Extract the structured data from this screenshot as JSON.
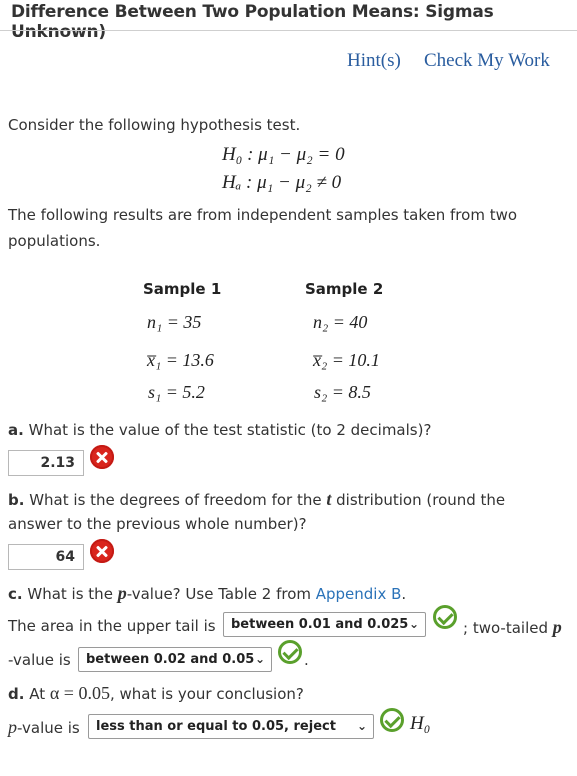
{
  "header": {
    "title": "Difference Between Two Population Means: Sigmas Unknown)",
    "hints_label": "Hint(s)",
    "check_label": "Check My Work"
  },
  "intro": {
    "line1": "Consider the following hypothesis test.",
    "h0": "H₀ : μ₁ − μ₂ = 0",
    "ha": "Hₐ : μ₁ − μ₂ ≠ 0",
    "line2a": "The following results are from independent samples taken from two",
    "line2b": "populations."
  },
  "samples": {
    "sample1_header": "Sample 1",
    "sample2_header": "Sample 2",
    "n1": "n₁ = 35",
    "n2": "n₂ = 40",
    "x1": "x̅₁ = 13.6",
    "x2": "x̅₂ = 10.1",
    "s1": "s₁  = 5.2",
    "s2": "s₂  = 8.5"
  },
  "question_a": {
    "letter": "a.",
    "text": "What is the value of the test statistic (to 2 decimals)?",
    "answer": "2.13",
    "status_icon": "incorrect-icon"
  },
  "question_b": {
    "letter": "b.",
    "text_pre": "What is the degrees of freedom for the ",
    "t": "t",
    "text_post": " distribution (round the",
    "text_line2": "answer to the previous whole number)?",
    "answer": "64",
    "status_icon": "incorrect-icon"
  },
  "question_c": {
    "letter": "c.",
    "text_pre": "What is the ",
    "p": "p",
    "text_mid": "-value? Use Table 2 from ",
    "link": "Appendix B",
    "text_end": ".",
    "upper_tail_label": "The area in the upper tail is",
    "upper_tail_value": "between 0.01 and 0.025",
    "two_tailed_label": "; two-tailed",
    "p2": "p",
    "value_is": "-value is",
    "two_tailed_value": "between 0.02 and 0.05",
    "period": "."
  },
  "question_d": {
    "letter": "d.",
    "text_pre": "At ",
    "alpha": "α = 0.05",
    "text_post": ", what is your conclusion?",
    "p": "p",
    "value_is": "-value is",
    "conclusion_value": "less than or equal to 0.05, reject",
    "h0": "H₀"
  },
  "colors": {
    "link": "#2a5d9f",
    "incorrect": "#d9251d",
    "correct": "#5aa02c"
  }
}
